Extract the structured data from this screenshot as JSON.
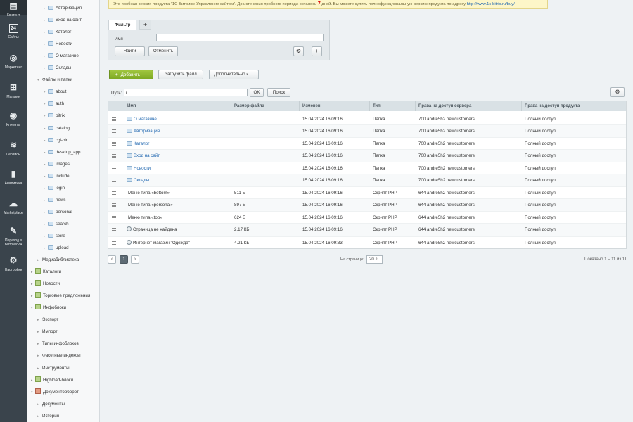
{
  "rail": [
    {
      "label": "Контент",
      "icon": "content-icon",
      "top": 0,
      "active": true
    },
    {
      "label": "Сайты",
      "icon": "sites-icon"
    },
    {
      "label": "Маркетинг",
      "icon": "marketing-icon"
    },
    {
      "label": "Магазин",
      "icon": "shop-icon"
    },
    {
      "label": "Клиенты",
      "icon": "clients-icon"
    },
    {
      "label": "Сервисы",
      "icon": "services-icon"
    },
    {
      "label": "Аналитика",
      "icon": "analytics-icon"
    },
    {
      "label": "Marketplace",
      "icon": "marketplace-icon"
    },
    {
      "label": "Переход в Битрикс24",
      "icon": "bitrix24-icon"
    },
    {
      "label": "Настройки",
      "icon": "settings-icon"
    }
  ],
  "tree": [
    {
      "label": "Авторизация",
      "type": "folder",
      "level": 3
    },
    {
      "label": "Вход на сайт",
      "type": "folder",
      "level": 3
    },
    {
      "label": "Каталог",
      "type": "folder",
      "level": 3
    },
    {
      "label": "Новости",
      "type": "folder",
      "level": 3
    },
    {
      "label": "О магазине",
      "type": "folder",
      "level": 3
    },
    {
      "label": "Склады",
      "type": "folder",
      "level": 3
    },
    {
      "label": "Файлы и папки",
      "type": "text",
      "level": 2,
      "expanded": true
    },
    {
      "label": "about",
      "type": "folder",
      "level": 3
    },
    {
      "label": "auth",
      "type": "folder",
      "level": 3
    },
    {
      "label": "bitrix",
      "type": "folder",
      "level": 3
    },
    {
      "label": "catalog",
      "type": "folder",
      "level": 3
    },
    {
      "label": "cgi-bin",
      "type": "folder",
      "level": 3
    },
    {
      "label": "desktop_app",
      "type": "folder",
      "level": 3
    },
    {
      "label": "images",
      "type": "folder",
      "level": 3
    },
    {
      "label": "include",
      "type": "folder",
      "level": 3
    },
    {
      "label": "login",
      "type": "folder",
      "level": 3
    },
    {
      "label": "news",
      "type": "folder",
      "level": 3
    },
    {
      "label": "personal",
      "type": "folder",
      "level": 3
    },
    {
      "label": "search",
      "type": "folder",
      "level": 3
    },
    {
      "label": "store",
      "type": "folder",
      "level": 3
    },
    {
      "label": "upload",
      "type": "folder",
      "level": 3
    },
    {
      "label": "Медиабиблиотека",
      "type": "text",
      "level": 2
    },
    {
      "label": "Каталоги",
      "type": "iblock",
      "level": 1
    },
    {
      "label": "Новости",
      "type": "iblock",
      "level": 1
    },
    {
      "label": "Торговые предложения",
      "type": "iblock",
      "level": 1
    },
    {
      "label": "Инфоблоки",
      "type": "iblock",
      "level": 1,
      "expanded": true
    },
    {
      "label": "Экспорт",
      "type": "text",
      "level": 2
    },
    {
      "label": "Импорт",
      "type": "text",
      "level": 2
    },
    {
      "label": "Типы инфоблоков",
      "type": "text",
      "level": 2
    },
    {
      "label": "Фасетные индексы",
      "type": "text",
      "level": 2
    },
    {
      "label": "Инструменты",
      "type": "text",
      "level": 2
    },
    {
      "label": "Highload-блоки",
      "type": "iblock",
      "level": 1
    },
    {
      "label": "Документооборот",
      "type": "iblock-red",
      "level": 1,
      "expanded": true
    },
    {
      "label": "Документы",
      "type": "text",
      "level": 2
    },
    {
      "label": "История",
      "type": "text",
      "level": 2
    }
  ],
  "trial": {
    "before": "Это пробная версия продукта \"1С-Битрикс: Управление сайтом\". До истечения пробного периода осталось",
    "days": "7",
    "after": "дней. Вы можете купить полнофункциональную версию продукта по адресу",
    "link": "http://www.1c-bitrix.ru/buy/"
  },
  "filter": {
    "tab_label": "Фильтр",
    "add_tab": "+",
    "collapse": "—",
    "name_label": "Имя",
    "name_value": "",
    "find": "Найти",
    "cancel": "Отменить"
  },
  "toolbar": {
    "add": "Добавить",
    "upload": "Загрузить файл",
    "more": "Дополнительно"
  },
  "path": {
    "label": "Путь:",
    "value": "/",
    "ok": "OK",
    "search": "Поиск"
  },
  "grid": {
    "columns": [
      "Имя",
      "Размер файла",
      "Изменен",
      "Тип",
      "Права на доступ сервера",
      "Права на доступ продукта"
    ],
    "rows": [
      {
        "name": "О магазине",
        "size": "",
        "modified": "15.04.2024 16:09:16",
        "type": "Папка",
        "server": "700 andre5h2 newcustomers",
        "product": "Полный доступ",
        "kind": "folder"
      },
      {
        "name": "Авторизация",
        "size": "",
        "modified": "15.04.2024 16:09:16",
        "type": "Папка",
        "server": "700 andre5h2 newcustomers",
        "product": "Полный доступ",
        "kind": "folder"
      },
      {
        "name": "Каталог",
        "size": "",
        "modified": "15.04.2024 16:09:16",
        "type": "Папка",
        "server": "700 andre5h2 newcustomers",
        "product": "Полный доступ",
        "kind": "folder"
      },
      {
        "name": "Вход на сайт",
        "size": "",
        "modified": "15.04.2024 16:09:16",
        "type": "Папка",
        "server": "700 andre5h2 newcustomers",
        "product": "Полный доступ",
        "kind": "folder"
      },
      {
        "name": "Новости",
        "size": "",
        "modified": "15.04.2024 16:09:16",
        "type": "Папка",
        "server": "700 andre5h2 newcustomers",
        "product": "Полный доступ",
        "kind": "folder"
      },
      {
        "name": "Склады",
        "size": "",
        "modified": "15.04.2024 16:09:16",
        "type": "Папка",
        "server": "700 andre5h2 newcustomers",
        "product": "Полный доступ",
        "kind": "folder"
      },
      {
        "name": "Меню типа «bottom»",
        "size": "511 Б",
        "modified": "15.04.2024 16:09:16",
        "type": "Скрипт PHP",
        "server": "644 andre5h2 newcustomers",
        "product": "Полный доступ",
        "kind": "menu"
      },
      {
        "name": "Меню типа «personal»",
        "size": "897 Б",
        "modified": "15.04.2024 16:09:16",
        "type": "Скрипт PHP",
        "server": "644 andre5h2 newcustomers",
        "product": "Полный доступ",
        "kind": "menu"
      },
      {
        "name": "Меню типа «top»",
        "size": "624 Б",
        "modified": "15.04.2024 16:09:16",
        "type": "Скрипт PHP",
        "server": "644 andre5h2 newcustomers",
        "product": "Полный доступ",
        "kind": "menu"
      },
      {
        "name": "Страница не найдена",
        "size": "2.17 КБ",
        "modified": "15.04.2024 16:09:16",
        "type": "Скрипт PHP",
        "server": "644 andre5h2 newcustomers",
        "product": "Полный доступ",
        "kind": "page"
      },
      {
        "name": "Интернет-магазин \"Одежда\"",
        "size": "4.21 КБ",
        "modified": "15.04.2024 16:09:33",
        "type": "Скрипт PHP",
        "server": "644 andre5h2 newcustomers",
        "product": "Полный доступ",
        "kind": "page"
      }
    ]
  },
  "pager": {
    "prev": "‹",
    "current": "1",
    "next": "›",
    "per_page_label": "На странице:",
    "per_page": "20",
    "shown": "Показано 1 – 11 из 11"
  }
}
